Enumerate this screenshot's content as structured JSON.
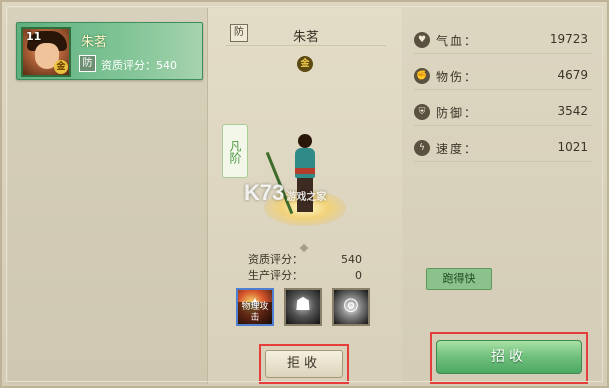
{
  "hero_list": {
    "items": [
      {
        "level": "11",
        "name": "朱茗",
        "role_badge": "防",
        "grade_badge": "金",
        "score_text": "资质评分：540"
      }
    ]
  },
  "detail": {
    "role_badge": "防",
    "name": "朱茗",
    "grade_badge": "金",
    "rank": "凡阶",
    "watermark": "K73",
    "watermark_sub": "游戏之家",
    "stats": [
      {
        "label": "资质评分：",
        "value": "540"
      },
      {
        "label": "生产评分：",
        "value": "0"
      }
    ],
    "skills": [
      {
        "icon": "physical-attack-skill-icon",
        "caption": "物理攻击"
      },
      {
        "icon": "shadow-skill-icon",
        "caption": ""
      },
      {
        "icon": "vortex-skill-icon",
        "caption": ""
      }
    ],
    "reject_label": "拒收"
  },
  "attributes": [
    {
      "icon": "heart-icon",
      "label": "气血：",
      "value": "19723"
    },
    {
      "icon": "fist-icon",
      "label": "物伤：",
      "value": "4679"
    },
    {
      "icon": "shield-icon",
      "label": "防御：",
      "value": "3542"
    },
    {
      "icon": "lightning-icon",
      "label": "速度：",
      "value": "1021"
    }
  ],
  "speed_tag": "跑得快",
  "recruit_label": "招收",
  "colors": {
    "accent_green": "#6fbf7c",
    "highlight_red": "#e43d3a",
    "panel_bg": "#d9d2bd"
  }
}
